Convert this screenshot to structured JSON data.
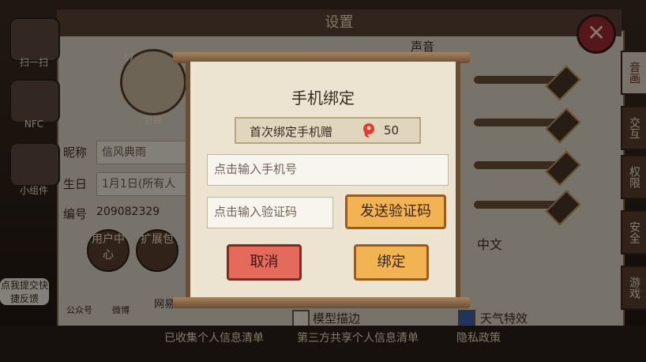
{
  "settings": {
    "title": "设置",
    "side_tabs": [
      "音画",
      "交互",
      "权限",
      "安全",
      "游戏"
    ],
    "left_icons": [
      {
        "label": "扫一扫",
        "icon": "scan-icon"
      },
      {
        "label": "NFC",
        "icon": "nfc-icon"
      },
      {
        "label": "小组件",
        "icon": "widget-icon"
      }
    ],
    "profile": {
      "level": "47",
      "change_label": "更换",
      "nickname_label": "昵称",
      "nickname_value": "信风典雨",
      "birthday_label": "生日",
      "birthday_value": "1月1日(所有人",
      "id_label": "编号",
      "id_value": "209082329"
    },
    "buttons": {
      "user_center": "用户中心",
      "expand_pack": "扩展包"
    },
    "social": {
      "wechat": "公众号",
      "weibo": "微博",
      "netease": "网易"
    },
    "feedback_bubble": "点我提交快捷反馈",
    "sound_header": "声音",
    "language_value": "中文",
    "checkbox_model_outline": "模型描边",
    "checkbox_weather": "天气特效",
    "bottom_links": [
      "已收集个人信息清单",
      "第三方共享个人信息清单",
      "隐私政策"
    ]
  },
  "dialog": {
    "title": "手机绑定",
    "reward_label": "首次绑定手机赠",
    "reward_count": "50",
    "phone_placeholder": "点击输入手机号",
    "code_placeholder": "点击输入验证码",
    "send_code_label": "发送验证码",
    "cancel_label": "取消",
    "confirm_label": "绑定"
  },
  "colors": {
    "primary_button": "#f2b452",
    "cancel_button": "#e46a5b",
    "dialog_bg": "#ece3d0"
  }
}
